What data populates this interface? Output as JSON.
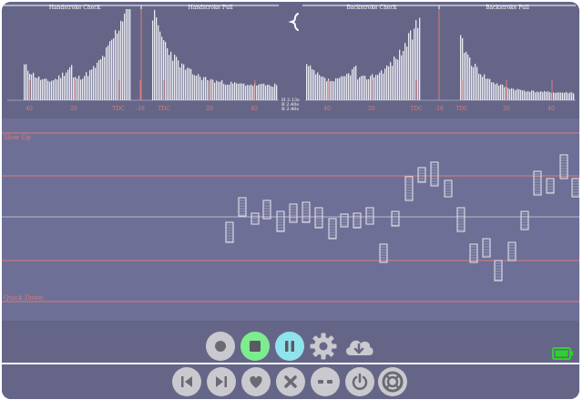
{
  "strike_panels": {
    "titles": [
      "Handstroke Check",
      "Handstroke Pull",
      "Backstroke Check",
      "Backstroke Pull"
    ],
    "left_ticks": [
      "40",
      "20",
      "TDC",
      "-18",
      "TDC",
      "20",
      "40"
    ],
    "right_ticks": [
      "40",
      "20",
      "TDC",
      "-18",
      "TDC",
      "20",
      "40"
    ],
    "legend": [
      "H 2.13s",
      "B 2.40s",
      "R 2.40s"
    ],
    "colors": {
      "accent": "#e07a7a",
      "bars": "#f4f4f8",
      "divider": "#ffffff"
    }
  },
  "timing_chart": {
    "slow_label": "Slow Up",
    "quick_label": "Quick Down",
    "colors": {
      "guide": "#e07a7a",
      "center": "#b9b9c9",
      "box": "#e8e8f0"
    }
  },
  "playback": {
    "buttons": [
      "record",
      "stop",
      "pause",
      "settings",
      "download"
    ],
    "icons": [
      "record-icon",
      "stop-icon",
      "pause-icon",
      "gear-icon",
      "cloud-download-icon"
    ],
    "colors": {
      "stop": "#7dec8e",
      "pause": "#8fe3ec",
      "neutral": "#c9c9cf"
    }
  },
  "navigation": {
    "buttons": [
      "skip-back",
      "skip-forward",
      "like",
      "delete",
      "tag",
      "power",
      "help"
    ],
    "icons": [
      "skip-back-icon",
      "skip-forward-icon",
      "heart-icon",
      "close-icon",
      "tag-icon",
      "power-icon",
      "lifebuoy-icon"
    ]
  },
  "battery": {
    "icon": "battery-icon",
    "color": "#30d030",
    "level": 0.75
  },
  "menu_icon": "chevron-left-icon"
}
